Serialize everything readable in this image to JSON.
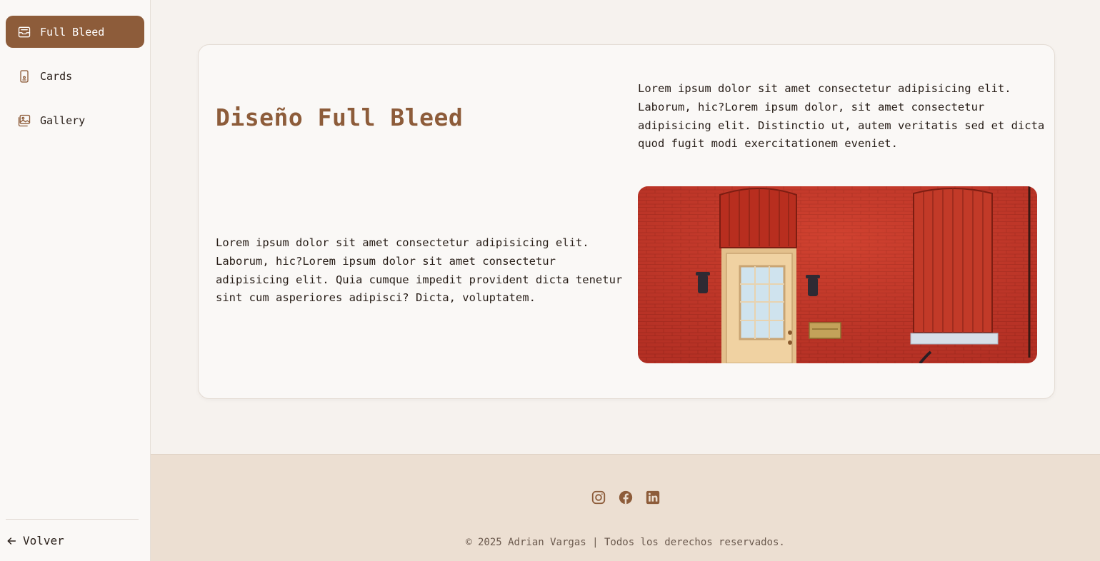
{
  "colors": {
    "accent": "#8d5c3a",
    "footer_bg": "#ecdfd2",
    "page_bg": "#f6f2ee"
  },
  "sidebar": {
    "items": [
      {
        "label": "Full Bleed",
        "icon": "inbox-icon",
        "active": true
      },
      {
        "label": "Cards",
        "icon": "phone-card-icon",
        "active": false
      },
      {
        "label": "Gallery",
        "icon": "image-gallery-icon",
        "active": false
      }
    ],
    "back_label": "Volver"
  },
  "main": {
    "title": "Diseño Full Bleed",
    "paragraph_right": "Lorem ipsum dolor sit amet consectetur adipisicing elit. Laborum, hic?Lorem ipsum dolor, sit amet consectetur adipisicing elit. Distinctio ut, autem veritatis sed et dicta quod fugit modi exercitationem eveniet.",
    "paragraph_left": "Lorem ipsum dolor sit amet consectetur adipisicing elit. Laborum, hic?Lorem ipsum dolor sit amet consectetur adipisicing elit. Quia cumque impedit provident dicta tenetur sint cum asperiores adipisci? Dicta, voluptatem.",
    "image_icon": "red-brick-house-photo"
  },
  "footer": {
    "socials": [
      "instagram-icon",
      "facebook-icon",
      "linkedin-icon"
    ],
    "copyright": "© 2025 Adrian Vargas | Todos los derechos reservados."
  }
}
